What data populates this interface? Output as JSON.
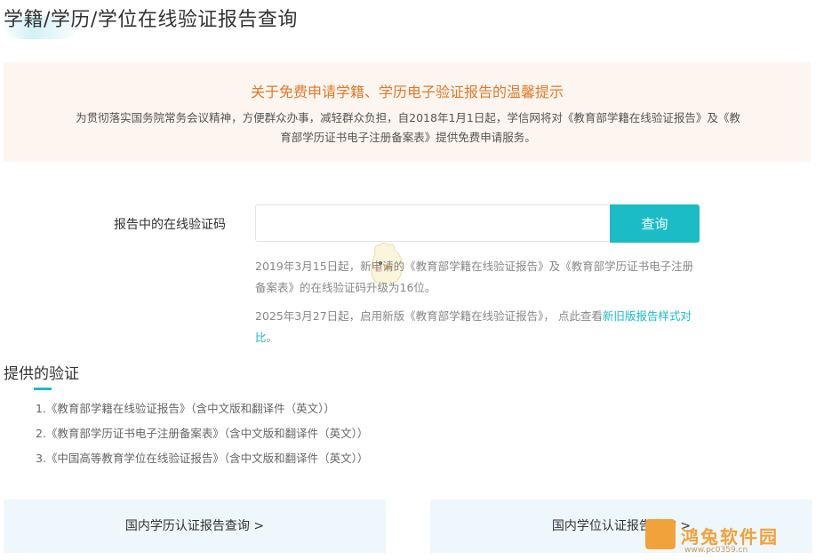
{
  "header": {
    "title": "学籍/学历/学位在线验证报告查询"
  },
  "notice": {
    "title": "关于免费申请学籍、学历电子验证报告的温馨提示",
    "body": "为贯彻落实国务院常务会议精神，方便群众办事，减轻群众负担，自2018年1月1日起，学信网将对《教育部学籍在线验证报告》及《教育部学历证书电子注册备案表》提供免费申请服务。"
  },
  "form": {
    "label": "报告中的在线验证码",
    "input_value": "",
    "input_placeholder": "",
    "button_label": "查询"
  },
  "hints": {
    "hint1": "2019年3月15日起，新申请的《教育部学籍在线验证报告》及《教育部学历证书电子注册备案表》的在线验证码升级为16位。",
    "hint2_prefix": "2025年3月27日起，启用新版《教育部学籍在线验证报告》， 点此查看",
    "hint2_link": "新旧版报告样式对比",
    "hint2_suffix": "。"
  },
  "provided": {
    "title": "提供的验证",
    "items": [
      "1.《教育部学籍在线验证报告》（含中文版和翻译件（英文））",
      "2.《教育部学历证书电子注册备案表》（含中文版和翻译件（英文））",
      "3.《中国高等教育学位在线验证报告》（含中文版和翻译件（英文））"
    ]
  },
  "cards": {
    "left": "国内学历认证报告查询 >",
    "right": "国内学位认证报告查询 >"
  },
  "watermark": {
    "text": "鸿兔软件园",
    "url": "www.pc0359.cn"
  },
  "colors": {
    "accent": "#1bbcc5",
    "notice_title": "#e07a2a",
    "notice_bg": "#fdf5ef",
    "card_bg": "#eef7fc"
  }
}
